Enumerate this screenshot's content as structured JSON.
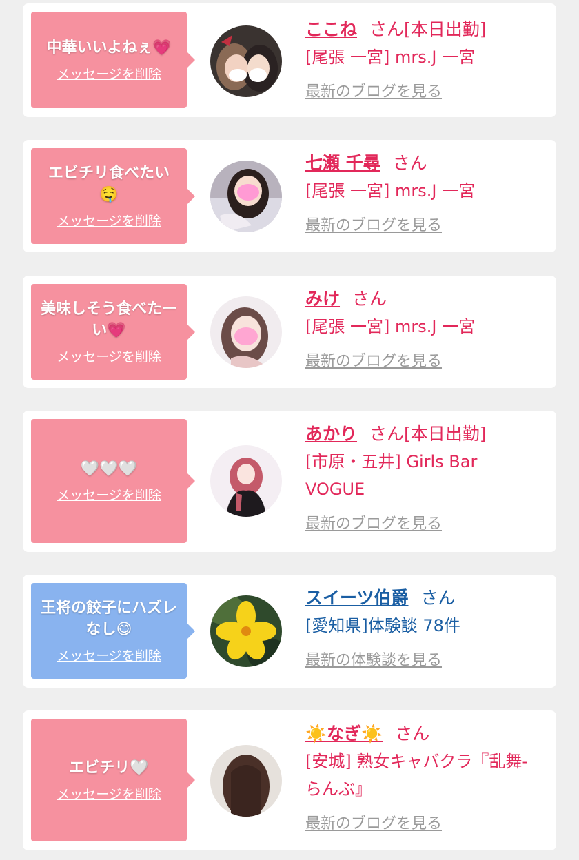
{
  "colors": {
    "page_bg": "#efefef",
    "bubble_pink": "#f6919f",
    "bubble_blue": "#89b3ef",
    "name_red": "#e2285a",
    "name_blue": "#1a5ea3",
    "link_gray": "#9a9a9a"
  },
  "delete_label": "メッセージを削除",
  "entries": [
    {
      "message": "中華いいよねぇ",
      "message_emoji": "💗",
      "name": "ここね",
      "suffix": "さん",
      "badge": "[本日出勤]",
      "detail": "[尾張 一宮] mrs.J 一宮",
      "link": "最新のブログを見る"
    },
    {
      "message": "エビチリ食べたい",
      "message_emoji": "🤤",
      "name": "七瀬 千尋",
      "suffix": "さん",
      "badge": "",
      "detail": "[尾張 一宮] mrs.J 一宮",
      "link": "最新のブログを見る"
    },
    {
      "message": "美味しそう食べたーい",
      "message_emoji": "💗",
      "name": "みけ",
      "suffix": "さん",
      "badge": "",
      "detail": "[尾張 一宮] mrs.J 一宮",
      "link": "最新のブログを見る"
    },
    {
      "message": "",
      "message_emoji": "🤍🤍🤍",
      "name": "あかり",
      "suffix": "さん",
      "badge": "[本日出勤]",
      "detail": "[市原・五井] Girls Bar VOGUE",
      "link": "最新のブログを見る"
    },
    {
      "message": "王将の餃子にハズレなし",
      "message_emoji": "😋",
      "name": "スイーツ伯爵",
      "suffix": "さん",
      "badge": "",
      "detail": "[愛知県]体験談 78件",
      "link": "最新の体験談を見る"
    },
    {
      "message": "エビチリ",
      "message_emoji": "🤍",
      "name": "☀️なぎ☀️",
      "suffix": "さん",
      "badge": "",
      "detail": "[安城] 熟女キャバクラ『乱舞-らんぶ』",
      "link": "最新のブログを見る"
    }
  ]
}
